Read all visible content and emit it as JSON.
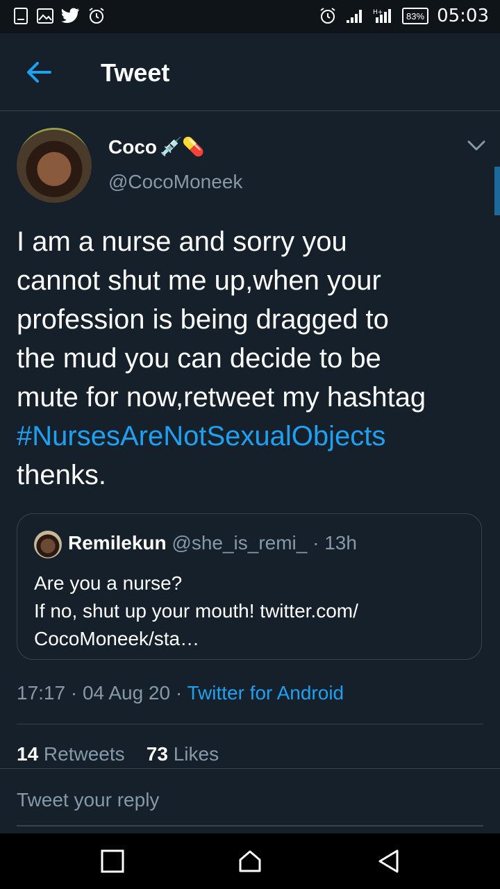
{
  "status_bar": {
    "time": "05:03",
    "battery": "83%",
    "icons": [
      "document-icon",
      "image-icon",
      "twitter-icon",
      "alarm-icon",
      "alarm-icon",
      "signal-icon",
      "signal-h-icon"
    ]
  },
  "header": {
    "title": "Tweet",
    "back_icon": "arrow-left-icon"
  },
  "tweet": {
    "author_name": "Coco",
    "author_emoji": "💉💊",
    "author_handle": "@CocoMoneek",
    "text_lines": [
      "I am a nurse and sorry you",
      "cannot shut me up,when your",
      "profession is being dragged to",
      "the mud you can decide to be",
      "mute for now,retweet my hashtag"
    ],
    "hashtag": "#NursesAreNotSexualObjects",
    "text_end": "thenks.",
    "timestamp": "17:17 · 04 Aug 20 · ",
    "source": "Twitter for Android",
    "retweet_count": "14",
    "retweet_label": " Retweets",
    "like_count": "73",
    "like_label": " Likes"
  },
  "quoted_tweet": {
    "name": "Remilekun",
    "handle_time": " @she_is_remi_ · 13h",
    "line1": "Are you a nurse?",
    "line2": "If no, shut up your mouth! twitter.com/",
    "line3": "CocoMoneek/sta…"
  },
  "reply": {
    "placeholder": "Tweet your reply"
  },
  "colors": {
    "background": "#15202b",
    "accent": "#1da1f2",
    "secondary_text": "#8899a6",
    "border": "#38444d"
  }
}
